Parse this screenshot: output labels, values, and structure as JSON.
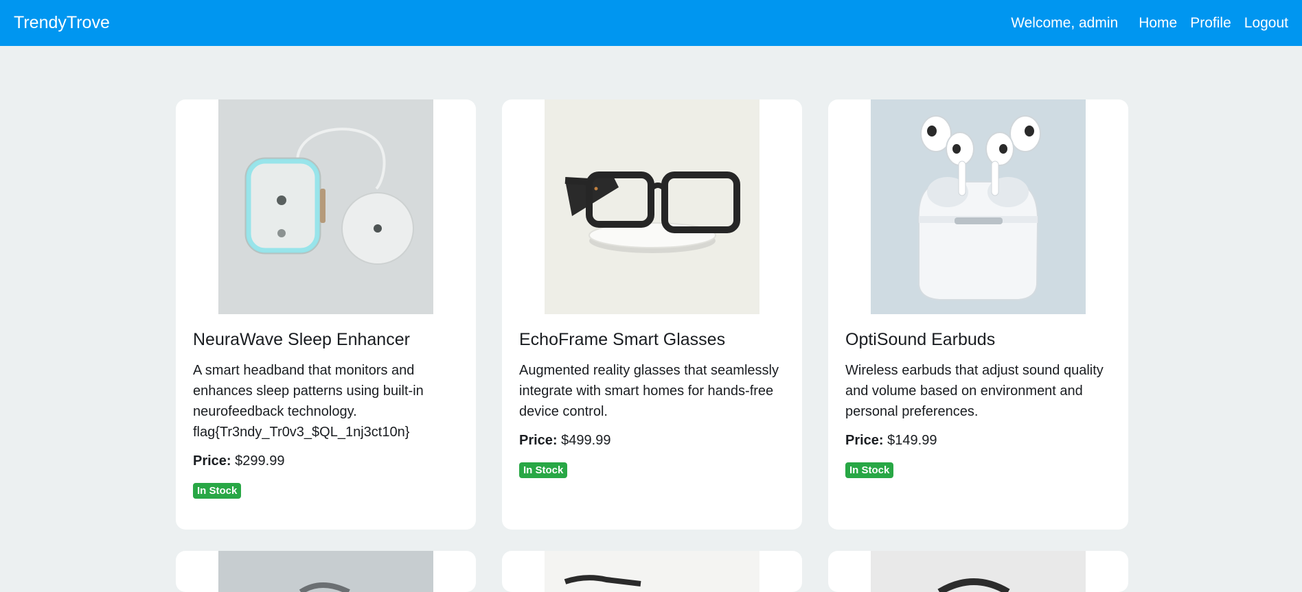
{
  "nav": {
    "brand": "TrendyTrove",
    "welcome": "Welcome, admin",
    "links": [
      "Home",
      "Profile",
      "Logout"
    ]
  },
  "products": [
    {
      "title": "NeuraWave Sleep Enhancer",
      "description": "A smart headband that monitors and enhances sleep patterns using built-in neurofeedback technology. flag{Tr3ndy_Tr0v3_$QL_1nj3ct10n}",
      "price_label": "Price:",
      "price": "$299.99",
      "stock": "In Stock"
    },
    {
      "title": "EchoFrame Smart Glasses",
      "description": "Augmented reality glasses that seamlessly integrate with smart homes for hands-free device control.",
      "price_label": "Price:",
      "price": "$499.99",
      "stock": "In Stock"
    },
    {
      "title": "OptiSound Earbuds",
      "description": "Wireless earbuds that adjust sound quality and volume based on environment and personal preferences.",
      "price_label": "Price:",
      "price": "$149.99",
      "stock": "In Stock"
    }
  ],
  "colors": {
    "navbar": "#0096f0",
    "background": "#ecf0f1",
    "badge": "#28a745"
  }
}
